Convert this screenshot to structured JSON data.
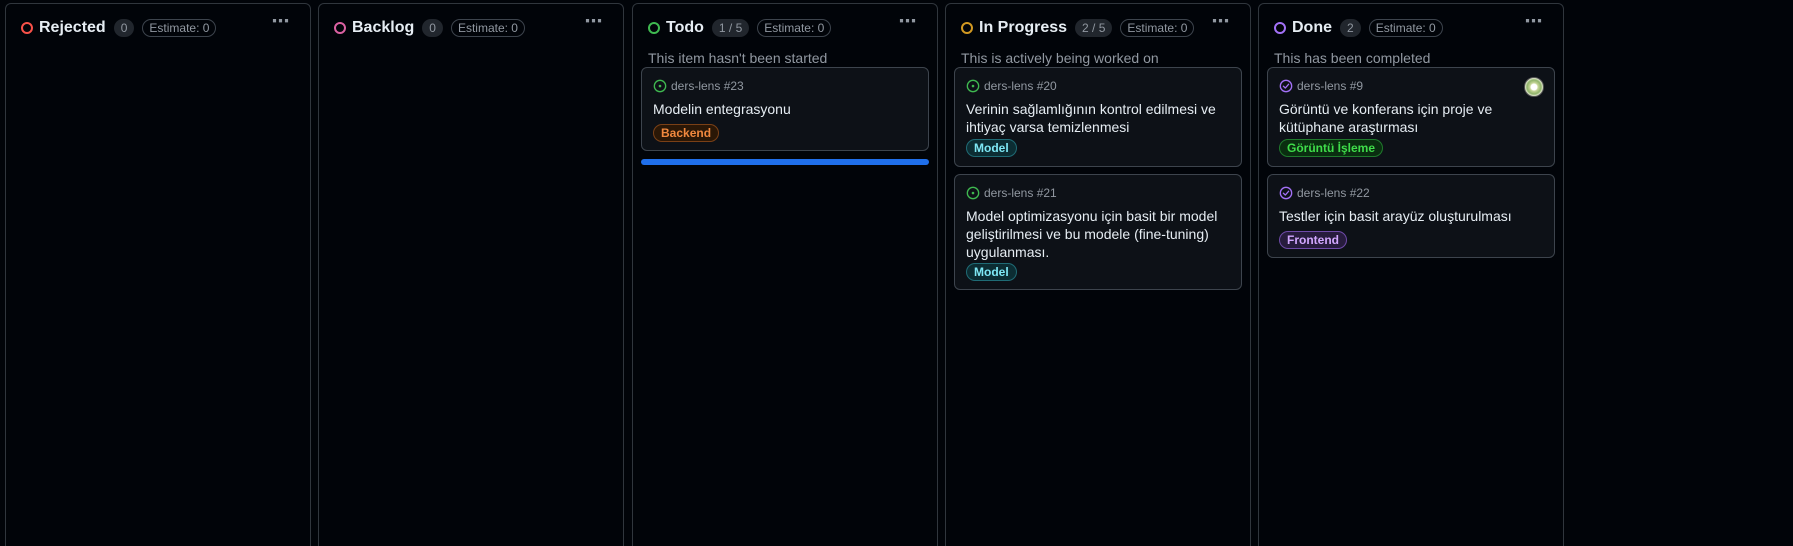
{
  "colors": {
    "red": "#f85149",
    "pink": "#db61a2",
    "green": "#3fb950",
    "orange": "#d29922",
    "purple": "#a371f7",
    "blue": "#1f6feb"
  },
  "columns": [
    {
      "title": "Rejected",
      "count": "0",
      "estimate": "Estimate: 0",
      "description": "",
      "status_icon": "red-circle-icon",
      "cards": []
    },
    {
      "title": "Backlog",
      "count": "0",
      "estimate": "Estimate: 0",
      "description": "",
      "status_icon": "pink-circle-icon",
      "cards": []
    },
    {
      "title": "Todo",
      "count": "1 / 5",
      "estimate": "Estimate: 0",
      "description": "This item hasn't been started",
      "status_icon": "green-circle-icon",
      "cards": [
        {
          "ref": "ders-lens #23",
          "title": "Modelin entegrasyonu",
          "label": "Backend",
          "state": "open"
        }
      ]
    },
    {
      "title": "In Progress",
      "count": "2 / 5",
      "estimate": "Estimate: 0",
      "description": "This is actively being worked on",
      "status_icon": "orange-circle-icon",
      "cards": [
        {
          "ref": "ders-lens #20",
          "title": "Verinin sağlamlığının kontrol edilmesi ve ihtiyaç varsa temizlenmesi",
          "label": "Model",
          "state": "open"
        },
        {
          "ref": "ders-lens #21",
          "title": "Model optimizasyonu için basit bir model geliştirilmesi ve bu modele (fine-tuning) uygulanması.",
          "label": "Model",
          "state": "open"
        }
      ]
    },
    {
      "title": "Done",
      "count": "2",
      "estimate": "Estimate: 0",
      "description": "This has been completed",
      "status_icon": "purple-circle-icon",
      "cards": [
        {
          "ref": "ders-lens #9",
          "title": "Görüntü ve konferans için proje ve kütüphane araştırması",
          "label": "Görüntü İşleme",
          "state": "closed",
          "has_avatar": true
        },
        {
          "ref": "ders-lens #22",
          "title": "Testler için basit arayüz oluşturulması",
          "label": "Frontend",
          "state": "closed"
        }
      ]
    }
  ],
  "more_icon": "⋯"
}
